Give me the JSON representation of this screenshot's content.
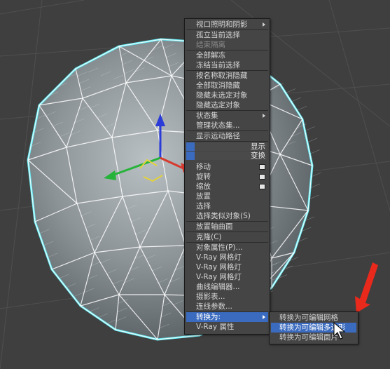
{
  "colors": {
    "menu_bg": "#454545",
    "menu_text": "#d4d4d4",
    "highlight": "#3b6bbf",
    "wire": "#ffffff",
    "selection_outline": "#5fe9f2",
    "arrow": "#e8291c"
  },
  "quad_menu": {
    "items": [
      {
        "label": "视口照明和阴影",
        "arrow": true
      },
      {
        "label": "孤立当前选择"
      },
      {
        "label": "结束隔离",
        "disabled": true
      },
      {
        "label": "全部解冻"
      },
      {
        "label": "冻结当前选择"
      },
      {
        "label": "按名称取消隐藏"
      },
      {
        "label": "全部取消隐藏"
      },
      {
        "label": "隐藏未选定对象"
      },
      {
        "label": "隐藏选定对象"
      },
      {
        "label": "状态集",
        "arrow": true
      },
      {
        "label": "管理状态集..."
      },
      {
        "label": "显示运动路径"
      },
      {
        "label": "移动",
        "box": true
      },
      {
        "label": "旋转",
        "box": true
      },
      {
        "label": "缩放",
        "box": true
      },
      {
        "label": "放置"
      },
      {
        "label": "选择"
      },
      {
        "label": "选择类似对象(S)"
      },
      {
        "label": "放置轴曲面"
      },
      {
        "label": "克隆(C)"
      },
      {
        "label": "对象属性(P)..."
      },
      {
        "label": "V-Ray 网格灯"
      },
      {
        "label": "V-Ray 网格灯"
      },
      {
        "label": "V-Ray 网格灯"
      },
      {
        "label": "曲线编辑器..."
      },
      {
        "label": "摄影表..."
      },
      {
        "label": "连线参数..."
      },
      {
        "label": "转换为:",
        "arrow": true,
        "highlight": true
      },
      {
        "label": "V-Ray 属性"
      }
    ],
    "quadrant_labels": [
      "显示",
      "变换"
    ]
  },
  "sub_menu": {
    "items": [
      {
        "label": "转换为可编辑网格"
      },
      {
        "label": "转换为可编辑多边形",
        "highlight": true
      },
      {
        "label": "转换为可编辑面片"
      }
    ]
  }
}
